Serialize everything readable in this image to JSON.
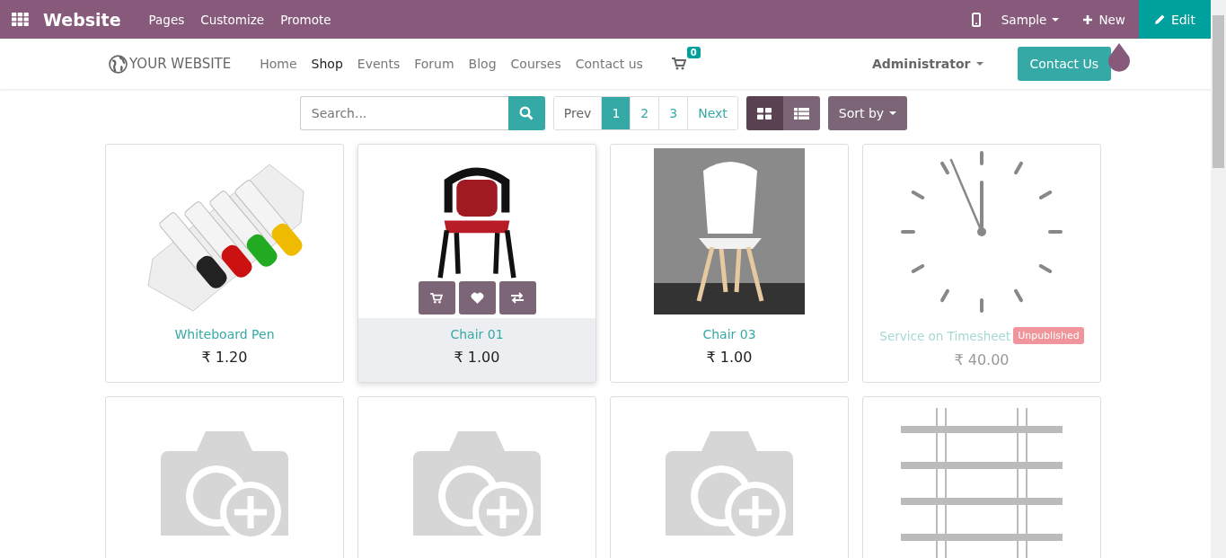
{
  "topbar": {
    "app": "Website",
    "menu": [
      "Pages",
      "Customize",
      "Promote"
    ],
    "sample": "Sample",
    "new": "New",
    "edit": "Edit"
  },
  "navbar": {
    "logo": "YOUR WEBSITE",
    "links": [
      {
        "label": "Home",
        "selected": false
      },
      {
        "label": "Shop",
        "selected": true
      },
      {
        "label": "Events",
        "selected": false
      },
      {
        "label": "Forum",
        "selected": false
      },
      {
        "label": "Blog",
        "selected": false
      },
      {
        "label": "Courses",
        "selected": false
      },
      {
        "label": "Contact us",
        "selected": false
      }
    ],
    "cart_count": "0",
    "user": "Administrator",
    "cta": "Contact Us"
  },
  "toolbar": {
    "search": {
      "placeholder": "Search..."
    },
    "pager": [
      {
        "label": "Prev",
        "selected": false
      },
      {
        "label": "1",
        "selected": true
      },
      {
        "label": "2",
        "selected": false
      },
      {
        "label": "3",
        "selected": false
      },
      {
        "label": "Next",
        "selected": false
      }
    ],
    "views": [
      {
        "kind": "grid",
        "selected": true
      },
      {
        "kind": "list",
        "selected": false
      }
    ],
    "sort": "Sort by"
  },
  "products": [
    {
      "kind": "pens",
      "name": "Whiteboard Pen",
      "price": "₹ 1.20",
      "published": true,
      "hovered": false
    },
    {
      "kind": "chair",
      "name": "Chair 01",
      "price": "₹ 1.00",
      "published": true,
      "hovered": true
    },
    {
      "kind": "chair-photo",
      "name": "Chair 03",
      "price": "₹ 1.00",
      "published": true,
      "hovered": false
    },
    {
      "kind": "clock",
      "name": "Service on Timesheet",
      "price": "₹ 40.00",
      "published": false,
      "badge": "Unpublished",
      "hovered": false
    },
    {
      "kind": "placeholder",
      "hovered": false
    },
    {
      "kind": "placeholder",
      "hovered": false
    },
    {
      "kind": "placeholder",
      "hovered": false
    },
    {
      "kind": "shelf",
      "hovered": false
    }
  ]
}
